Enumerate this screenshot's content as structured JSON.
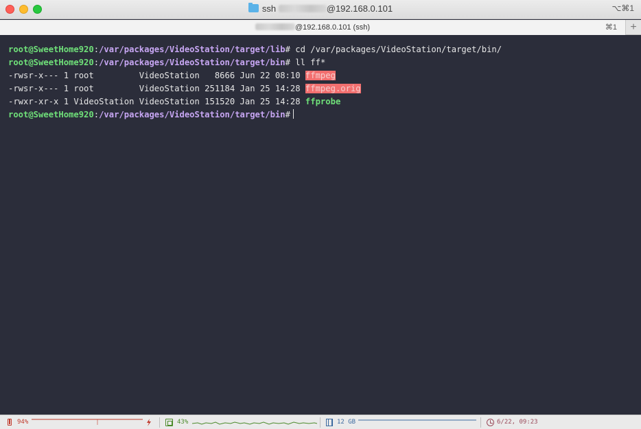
{
  "window": {
    "title_prefix": "ssh",
    "title_host": "@192.168.0.101",
    "shortcut": "⌥⌘1"
  },
  "tab": {
    "host_label": "@192.168.0.101 (ssh)",
    "shortcut": "⌘1",
    "add_label": "+"
  },
  "terminal": {
    "lines": [
      {
        "user": "root@SweetHome920",
        "sep": ":",
        "path": "/var/packages/VideoStation/target/lib",
        "prompt": "#",
        "command": " cd /var/packages/VideoStation/target/bin/"
      },
      {
        "user": "root@SweetHome920",
        "sep": ":",
        "path": "/var/packages/VideoStation/target/bin",
        "prompt": "#",
        "command": " ll ff*"
      },
      {
        "listing": "-rwsr-x--- 1 root         VideoStation   8666 Jun 22 08:10 ",
        "name": "ffmpeg"
      },
      {
        "listing": "-rwsr-x--- 1 root         VideoStation 251184 Jan 25 14:28 ",
        "name": "ffmpeg.orig"
      },
      {
        "listing": "-rwxr-xr-x 1 VideoStation VideoStation 151520 Jan 25 14:28 ",
        "name": "ffprobe"
      },
      {
        "user": "root@SweetHome920",
        "sep": ":",
        "path": "/var/packages/VideoStation/target/bin",
        "prompt": "#",
        "command": ""
      }
    ]
  },
  "status": {
    "battery": {
      "value": "94%",
      "level": 0.94,
      "color": "#c0392b",
      "icon": "battery-icon"
    },
    "cpu": {
      "value": "43%",
      "level": 0.43,
      "color": "#4a8a2a",
      "icon": "cpu-icon"
    },
    "memory": {
      "value": "12 GB",
      "color": "#3c6aa0",
      "icon": "memory-icon"
    },
    "clock": {
      "value": "6/22, 09:23",
      "color": "#9a4a5a",
      "icon": "clock-icon"
    }
  },
  "colors": {
    "terminal_bg": "#2b2d3a",
    "prompt_user": "#6fe079",
    "prompt_path": "#c7a6f3",
    "suid_highlight": "#f26f6f",
    "executable": "#6fe079"
  }
}
